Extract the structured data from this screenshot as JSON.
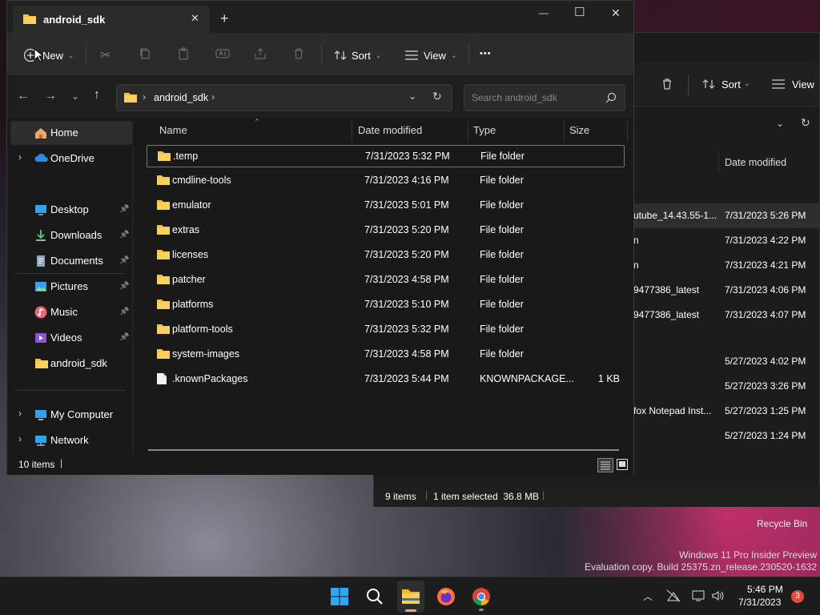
{
  "window": {
    "tab_title": "android_sdk",
    "new_tab": "+",
    "controls": {
      "minimize": "—",
      "maximize": "☐",
      "close": "✕"
    }
  },
  "toolbar": {
    "new_label": "New",
    "sort_label": "Sort",
    "view_label": "View",
    "more_label": "•••"
  },
  "address": {
    "path": "android_sdk",
    "search_placeholder": "Search android_sdk"
  },
  "sidebar": {
    "items": [
      {
        "label": "Home",
        "icon": "home-icon",
        "pinned": false,
        "expandable": false
      },
      {
        "label": "OneDrive",
        "icon": "cloud-icon",
        "pinned": false,
        "expandable": true
      },
      {
        "label": "Desktop",
        "icon": "desktop-icon",
        "pinned": true,
        "expandable": false
      },
      {
        "label": "Downloads",
        "icon": "download-icon",
        "pinned": true,
        "expandable": false
      },
      {
        "label": "Documents",
        "icon": "document-icon",
        "pinned": true,
        "expandable": false
      },
      {
        "label": "Pictures",
        "icon": "picture-icon",
        "pinned": true,
        "expandable": false
      },
      {
        "label": "Music",
        "icon": "music-icon",
        "pinned": true,
        "expandable": false
      },
      {
        "label": "Videos",
        "icon": "video-icon",
        "pinned": true,
        "expandable": false
      },
      {
        "label": "android_sdk",
        "icon": "folder-icon",
        "pinned": false,
        "expandable": false
      },
      {
        "label": "My Computer",
        "icon": "computer-icon",
        "pinned": false,
        "expandable": true
      },
      {
        "label": "Network",
        "icon": "network-icon",
        "pinned": false,
        "expandable": true
      }
    ]
  },
  "table": {
    "columns": [
      "Name",
      "Date modified",
      "Type",
      "Size"
    ],
    "rows": [
      {
        "name": ".temp",
        "date": "7/31/2023 5:32 PM",
        "type": "File folder",
        "size": "",
        "kind": "folder"
      },
      {
        "name": "cmdline-tools",
        "date": "7/31/2023 4:16 PM",
        "type": "File folder",
        "size": "",
        "kind": "folder"
      },
      {
        "name": "emulator",
        "date": "7/31/2023 5:01 PM",
        "type": "File folder",
        "size": "",
        "kind": "folder"
      },
      {
        "name": "extras",
        "date": "7/31/2023 5:20 PM",
        "type": "File folder",
        "size": "",
        "kind": "folder"
      },
      {
        "name": "licenses",
        "date": "7/31/2023 5:20 PM",
        "type": "File folder",
        "size": "",
        "kind": "folder"
      },
      {
        "name": "patcher",
        "date": "7/31/2023 4:58 PM",
        "type": "File folder",
        "size": "",
        "kind": "folder"
      },
      {
        "name": "platforms",
        "date": "7/31/2023 5:10 PM",
        "type": "File folder",
        "size": "",
        "kind": "folder"
      },
      {
        "name": "platform-tools",
        "date": "7/31/2023 5:32 PM",
        "type": "File folder",
        "size": "",
        "kind": "folder"
      },
      {
        "name": "system-images",
        "date": "7/31/2023 4:58 PM",
        "type": "File folder",
        "size": "",
        "kind": "folder"
      },
      {
        "name": ".knownPackages",
        "date": "7/31/2023 5:44 PM",
        "type": "KNOWNPACKAGE...",
        "size": "1 KB",
        "kind": "file"
      }
    ]
  },
  "status": {
    "items_count": "10 items"
  },
  "background_window": {
    "sort_label": "Sort",
    "view_label": "View",
    "date_header": "Date modified",
    "rows": [
      {
        "name": "utube_14.43.55-1...",
        "date": "7/31/2023 5:26 PM"
      },
      {
        "name": "n",
        "date": "7/31/2023 4:22 PM"
      },
      {
        "name": "n",
        "date": "7/31/2023 4:21 PM"
      },
      {
        "name": "9477386_latest",
        "date": "7/31/2023 4:06 PM"
      },
      {
        "name": "9477386_latest",
        "date": "7/31/2023 4:07 PM"
      },
      {
        "name": "",
        "date": "5/27/2023 4:02 PM"
      },
      {
        "name": "",
        "date": "5/27/2023 3:26 PM"
      },
      {
        "name": "fox Notepad Inst...",
        "date": "5/27/2023 1:25 PM"
      },
      {
        "name": "",
        "date": "5/27/2023 1:24 PM"
      }
    ],
    "status_count": "9 items",
    "status_selected": "1 item selected  36.8 MB"
  },
  "desktop": {
    "recycle_bin": "Recycle Bin",
    "watermark_line1": "Windows 11 Pro Insider Preview",
    "watermark_line2": "Evaluation copy. Build 25375.zn_release.230520-1632"
  },
  "taskbar": {
    "time": "5:46 PM",
    "date": "7/31/2023",
    "notification_count": "3"
  },
  "colors": {
    "accent": "#0078d4",
    "folder": "#f5c142",
    "notification": "#e04a3a"
  }
}
